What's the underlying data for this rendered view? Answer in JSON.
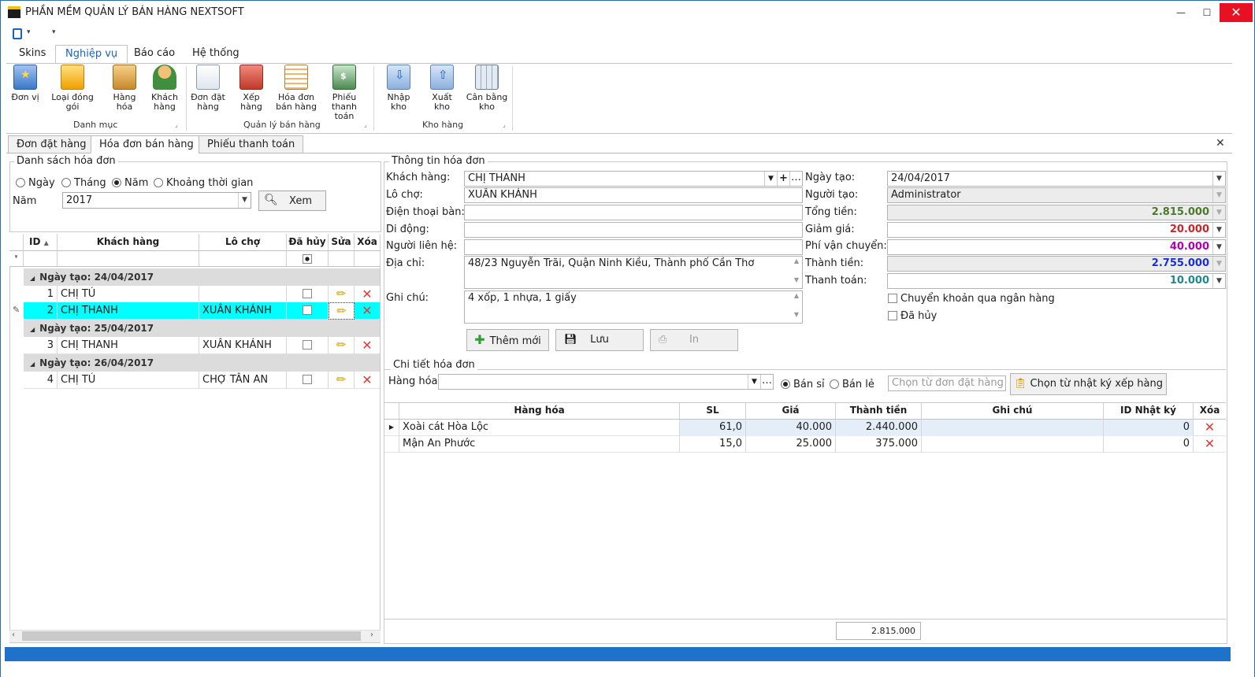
{
  "window": {
    "title": "PHẦN MỀM QUẢN LÝ BÁN HÀNG NEXTSOFT",
    "min": "🗕",
    "max": "🗖",
    "close": "✕"
  },
  "ribbon": {
    "tabs": [
      "Skins",
      "Nghiệp vụ",
      "Báo cáo",
      "Hệ thống"
    ],
    "groups": [
      {
        "label": "Danh mục",
        "buttons": [
          "Đơn vị",
          "Loại đóng gói",
          "Hàng hóa",
          "Khách hàng"
        ]
      },
      {
        "label": "Quản lý bán hàng",
        "buttons": [
          "Đơn đặt hàng",
          "Xếp hàng",
          "Hóa đơn bán hàng",
          "Phiếu thanh toán"
        ]
      },
      {
        "label": "Kho hàng",
        "buttons": [
          "Nhập kho",
          "Xuất kho",
          "Cân bằng kho"
        ]
      }
    ],
    "btn_lines": {
      "khachhang": [
        "Khách",
        "hàng"
      ],
      "dondathang": [
        "Đơn đặt",
        "hàng"
      ],
      "hoadon": [
        "Hóa đơn",
        "bán hàng"
      ],
      "phieu": [
        "Phiếu",
        "thanh toán"
      ],
      "canbang": [
        "Cân bằng",
        "kho"
      ]
    }
  },
  "doc_tabs": [
    "Đơn đặt hàng",
    "Hóa đơn bán hàng",
    "Phiếu thanh toán"
  ],
  "left": {
    "legend": "Danh sách hóa đơn",
    "filters": [
      "Ngày",
      "Tháng",
      "Năm",
      "Khoảng thời gian"
    ],
    "selected_filter": "Năm",
    "year_label": "Năm",
    "year_value": "2017",
    "view_button": "Xem",
    "columns": [
      "ID",
      "Khách hàng",
      "Lô chợ",
      "Đã hủy",
      "Sửa",
      "Xóa"
    ],
    "groups": [
      {
        "label": "Ngày tạo: 24/04/2017",
        "rows": [
          {
            "id": "1",
            "customer": "CHỊ TÚ",
            "market": ""
          },
          {
            "id": "2",
            "customer": "CHỊ THANH",
            "market": "XUÂN KHÁNH",
            "selected": true
          }
        ]
      },
      {
        "label": "Ngày tạo: 25/04/2017",
        "rows": [
          {
            "id": "3",
            "customer": "CHỊ THANH",
            "market": "XUÂN KHÁNH"
          }
        ]
      },
      {
        "label": "Ngày tạo: 26/04/2017",
        "rows": [
          {
            "id": "4",
            "customer": "CHỊ TÚ",
            "market": "CHỢ TÂN AN"
          }
        ]
      }
    ]
  },
  "invoice": {
    "legend": "Thông tin hóa đơn",
    "labels": {
      "customer": "Khách hàng:",
      "market": "Lô chợ:",
      "phone": "Điện thoại bàn:",
      "mobile": "Di động:",
      "contact": "Người liên hệ:",
      "address": "Địa chỉ:",
      "note": "Ghi chú:",
      "created": "Ngày tạo:",
      "creator": "Người tạo:",
      "total": "Tổng tiền:",
      "discount": "Giảm giá:",
      "shipping": "Phí vận chuyển:",
      "amount": "Thành tiền:",
      "paid": "Thanh toán:"
    },
    "values": {
      "customer": "CHỊ THANH",
      "market": "XUÂN KHÁNH",
      "phone": "",
      "mobile": "",
      "contact": "",
      "address": "48/23 Nguyễn Trãi, Quận Ninh Kiều, Thành phố Cần Thơ",
      "note": "4 xốp, 1 nhựa, 1 giấy",
      "created": "24/04/2017",
      "creator": "Administrator",
      "total": "2.815.000",
      "discount": "20.000",
      "shipping": "40.000",
      "amount": "2.755.000",
      "paid": "10.000"
    },
    "value_colors": {
      "total": "#4a7a2a",
      "discount": "#c62828",
      "shipping": "#b000b0",
      "amount": "#1a30d0",
      "paid": "#1a8a8a"
    },
    "checkboxes": [
      "Chuyển khoản qua ngân hàng",
      "Đã hủy"
    ],
    "buttons": {
      "add": "Thêm mới",
      "save": "Lưu",
      "print": "In"
    }
  },
  "details": {
    "legend": "Chi tiết hóa đơn",
    "product_label": "Hàng hóa",
    "modes": [
      "Bán sỉ",
      "Bán lẻ"
    ],
    "selected_mode": "Bán sỉ",
    "order_placeholder": "Chọn từ đơn đặt hàng",
    "log_button": "Chọn từ nhật ký xếp hàng",
    "columns": [
      "Hàng hóa",
      "SL",
      "Giá",
      "Thành tiền",
      "Ghi chú",
      "ID Nhật ký",
      "Xóa"
    ],
    "rows": [
      {
        "name": "Xoài cát Hòa Lộc",
        "qty": "61,0",
        "price": "40.000",
        "amount": "2.440.000",
        "note": "",
        "log_id": "0"
      },
      {
        "name": "Mận An Phước",
        "qty": "15,0",
        "price": "25.000",
        "amount": "375.000",
        "note": "",
        "log_id": "0"
      }
    ],
    "footer_total": "2.815.000"
  },
  "colors": {
    "accent": "#1565c0",
    "selected_row": "#00ffff",
    "status_bar": "#1f72c9",
    "close": "#e81123"
  }
}
